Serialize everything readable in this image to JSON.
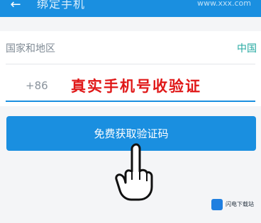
{
  "header": {
    "back_icon": "arrow-left-icon",
    "title": "绑定手机",
    "right_watermark": "www.xxx.com"
  },
  "form": {
    "region_label": "国家和地区",
    "region_value": "中国",
    "phone_prefix": "+86",
    "phone_placeholder": "真实手机号收验证"
  },
  "actions": {
    "get_code_label": "免费获取验证码"
  },
  "overlay": {
    "hand_icon": "pointing-hand-icon",
    "brand_text": "闪电下载站"
  },
  "colors": {
    "accent": "#1a8fe0",
    "region_value": "#23a8a0",
    "placeholder_red": "#e01818"
  }
}
